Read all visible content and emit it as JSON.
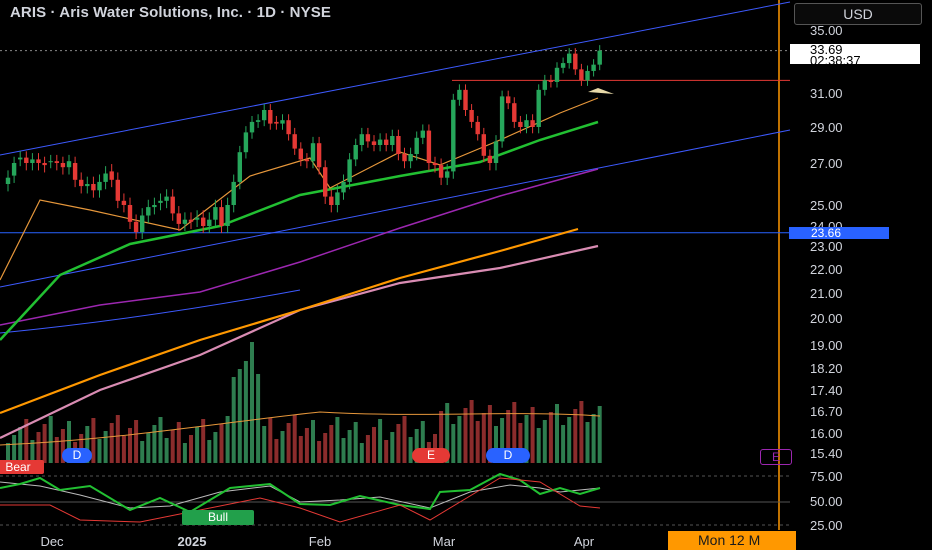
{
  "header": {
    "title": "ARIS · Aris Water Solutions, Inc. · 1D · NYSE",
    "currency": "USD"
  },
  "price_tag": {
    "price": "33.69",
    "countdown": "02:38:37"
  },
  "level_tag": "23.66",
  "date_tag": "Mon 12 M",
  "badges": {
    "bear": "Bear",
    "bull": "Bull",
    "d1": "D",
    "e1": "E",
    "d2": "D",
    "e2": "E"
  },
  "colors": {
    "up": "#26a65b",
    "down": "#e53935",
    "ma20": "#e6973b",
    "ma50": "#22c032",
    "ma100": "#9c27b0",
    "ma150": "#ff9800",
    "ma200": "#d98cb3",
    "channel": "#3d5afe",
    "level": "#2962ff",
    "resistance": "#e53935",
    "vline": "#ff9800"
  },
  "chart_data": {
    "type": "candlestick",
    "title": "ARIS · Aris Water Solutions, Inc. · 1D · NYSE",
    "y_ticks": [
      "35.00",
      "31.00",
      "29.00",
      "27.00",
      "25.00",
      "24.00",
      "23.00",
      "22.00",
      "21.00",
      "20.00",
      "19.00",
      "18.20",
      "17.40",
      "16.70",
      "16.00",
      "15.40"
    ],
    "rsi_ticks": [
      "75.00",
      "50.00",
      "25.00"
    ],
    "x_ticks": [
      "Dec",
      "2025",
      "Feb",
      "Mar",
      "Apr"
    ],
    "last_price": 33.69,
    "horizontal_level": 23.66,
    "resistance_level": 31.8,
    "closes": [
      26.3,
      27.0,
      27.3,
      27.0,
      27.2,
      27.0,
      26.9,
      27.1,
      27.0,
      26.8,
      27.1,
      26.2,
      25.9,
      26.0,
      25.7,
      26.1,
      26.5,
      26.2,
      25.2,
      25.0,
      24.2,
      23.7,
      24.5,
      24.9,
      25.0,
      25.2,
      25.4,
      24.6,
      24.1,
      24.3,
      24.2,
      24.4,
      24.0,
      24.3,
      24.9,
      24.0,
      25.0,
      26.1,
      27.6,
      28.7,
      29.3,
      29.4,
      30.0,
      29.2,
      29.2,
      29.4,
      28.6,
      27.8,
      27.2,
      27.1,
      28.1,
      26.8,
      25.4,
      25.0,
      25.6,
      26.1,
      27.2,
      28.0,
      28.6,
      28.2,
      28.0,
      28.3,
      28.0,
      28.5,
      27.5,
      27.1,
      27.5,
      28.4,
      28.8,
      27.0,
      26.9,
      26.3,
      26.6,
      30.6,
      31.2,
      30.0,
      29.3,
      28.6,
      27.4,
      27.0,
      28.2,
      30.8,
      30.4,
      29.3,
      29.0,
      29.4,
      29.0,
      31.2,
      31.8,
      31.7,
      32.6,
      32.9,
      33.5,
      32.5,
      31.8,
      32.4,
      32.8,
      33.69
    ],
    "opens": [
      26.0,
      26.4,
      27.2,
      27.3,
      27.0,
      27.2,
      27.0,
      27.1,
      27.1,
      27.0,
      26.8,
      27.0,
      26.2,
      25.9,
      26.0,
      25.7,
      26.1,
      26.6,
      26.2,
      25.2,
      25.0,
      24.2,
      23.7,
      24.5,
      24.9,
      25.1,
      25.2,
      25.4,
      24.6,
      24.1,
      24.3,
      24.3,
      24.4,
      24.0,
      24.3,
      24.9,
      24.0,
      25.0,
      26.1,
      27.6,
      28.7,
      29.3,
      29.4,
      30.0,
      29.3,
      29.2,
      29.4,
      28.6,
      27.8,
      27.2,
      27.1,
      28.1,
      26.8,
      25.4,
      25.0,
      25.6,
      26.1,
      27.2,
      28.0,
      28.6,
      28.2,
      28.0,
      28.3,
      28.0,
      28.5,
      27.5,
      27.1,
      27.5,
      28.4,
      28.8,
      27.0,
      26.9,
      26.3,
      26.6,
      30.6,
      31.2,
      30.0,
      29.3,
      28.6,
      27.4,
      27.0,
      28.2,
      30.8,
      30.4,
      29.3,
      29.0,
      29.4,
      29.0,
      31.2,
      31.8,
      31.7,
      32.6,
      32.9,
      33.5,
      32.5,
      31.8,
      32.4,
      32.8
    ],
    "ma20_last": 31.2,
    "ma50_last": 29.3,
    "ma100_last": 26.9,
    "ma150_last": 23.8,
    "ma200_last": 23.0,
    "volume_scale": "relative",
    "rsi_last": 65
  }
}
